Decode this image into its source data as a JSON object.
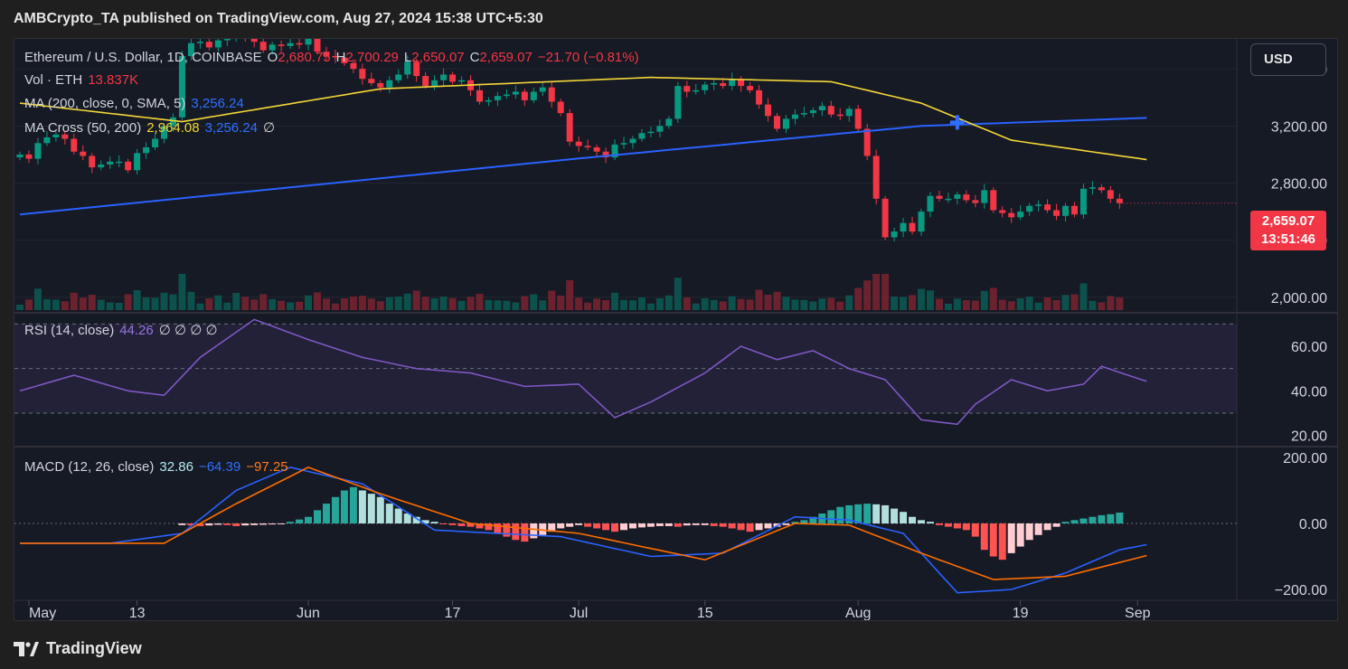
{
  "header": {
    "publisher": "AMBCrypto_TA published on TradingView.com, Aug 27, 2024 15:38 UTC+5:30"
  },
  "legend": {
    "symbol": "Ethereum / U.S. Dollar, 1D, COINBASE",
    "o_label": "O",
    "o_value": "2,680.75",
    "h_label": "H",
    "h_value": "2,700.29",
    "l_label": "L",
    "l_value": "2,650.07",
    "c_label": "C",
    "c_value": "2,659.07",
    "change": "−21.70 (−0.81%)",
    "vol_label": "Vol · ETH",
    "vol_value": "13.837K",
    "ma_label": "MA (200, close, 0, SMA, 5)",
    "ma_value": "3,256.24",
    "macross_label": "MA Cross (50, 200)",
    "macross_v1": "2,964.08",
    "macross_v2": "3,256.24",
    "macross_v3": "∅",
    "rsi_label": "RSI (14, close)",
    "rsi_value": "44.26",
    "rsi_extra": "∅ ∅ ∅ ∅",
    "macd_label": "MACD (12, 26, close)",
    "macd_hist": "32.86",
    "macd_line": "−64.39",
    "macd_signal": "−97.25"
  },
  "toolbar": {
    "currency_button": "USD"
  },
  "price_badge": {
    "price": "2,659.07",
    "countdown": "13:51:46"
  },
  "footer": {
    "brand": "TradingView"
  },
  "colors": {
    "background": "#161a25",
    "up": "#089981",
    "down": "#f23645",
    "ma200": "#2962ff",
    "ma50": "#f5d637",
    "rsi": "#7e57c2",
    "macd_line": "#2962ff",
    "macd_signal": "#ff6d00"
  },
  "chart_data": [
    {
      "type": "candlestick",
      "title": "Ethereum / U.S. Dollar, 1D, COINBASE",
      "y_ticks": [
        "3,600.00",
        "3,200.00",
        "2,800.00",
        "2,400.00",
        "2,000.00"
      ],
      "y_tick_values": [
        3600,
        3200,
        2800,
        2400,
        2000
      ],
      "ylim": [
        1910,
        3810
      ],
      "x_ticks": [
        "May",
        "13",
        "Jun",
        "17",
        "Jul",
        "15",
        "Aug",
        "19",
        "Sep"
      ],
      "x_tick_dates": [
        "2024-05-01",
        "2024-05-13",
        "2024-06-01",
        "2024-06-17",
        "2024-07-01",
        "2024-07-15",
        "2024-08-01",
        "2024-08-19",
        "2024-09-01"
      ],
      "start_date": "2024-04-30",
      "closes": [
        3000,
        2970,
        3080,
        3120,
        3140,
        3110,
        3020,
        2990,
        2910,
        2930,
        2950,
        2950,
        2890,
        3010,
        3050,
        3110,
        3200,
        3260,
        3690,
        3780,
        3790,
        3750,
        3800,
        3810,
        3890,
        3820,
        3790,
        3730,
        3770,
        3760,
        3780,
        3770,
        3820,
        3720,
        3690,
        3680,
        3640,
        3600,
        3530,
        3500,
        3470,
        3520,
        3560,
        3650,
        3550,
        3480,
        3520,
        3560,
        3510,
        3520,
        3450,
        3370,
        3380,
        3410,
        3420,
        3440,
        3380,
        3440,
        3470,
        3370,
        3290,
        3090,
        3060,
        3050,
        3020,
        2980,
        3070,
        3080,
        3110,
        3150,
        3160,
        3200,
        3250,
        3480,
        3440,
        3450,
        3490,
        3500,
        3480,
        3530,
        3480,
        3450,
        3350,
        3270,
        3180,
        3250,
        3280,
        3290,
        3310,
        3340,
        3280,
        3270,
        3320,
        3180,
        2990,
        2690,
        2420,
        2460,
        2520,
        2460,
        2600,
        2710,
        2690,
        2690,
        2720,
        2680,
        2660,
        2750,
        2610,
        2590,
        2560,
        2600,
        2640,
        2650,
        2610,
        2570,
        2640,
        2580,
        2760,
        2770,
        2750,
        2690,
        2659
      ],
      "ma200": [
        {
          "day": 0,
          "value": 2580
        },
        {
          "day": 60,
          "value": 2960
        },
        {
          "day": 100,
          "value": 3200
        },
        {
          "day": 125,
          "value": 3256.24
        }
      ],
      "ma50": [
        {
          "day": 0,
          "value": 3360
        },
        {
          "day": 18,
          "value": 3230
        },
        {
          "day": 40,
          "value": 3460
        },
        {
          "day": 70,
          "value": 3540
        },
        {
          "day": 90,
          "value": 3510
        },
        {
          "day": 100,
          "value": 3360
        },
        {
          "day": 110,
          "value": 3100
        },
        {
          "day": 125,
          "value": 2964.08
        }
      ],
      "cross_marker": {
        "day": 104,
        "value": 3225
      },
      "last_price": 2659.07
    },
    {
      "type": "line",
      "title": "RSI (14, close)",
      "y_ticks": [
        "60.00",
        "40.00",
        "20.00"
      ],
      "y_tick_values": [
        60,
        40,
        20
      ],
      "ylim": [
        15,
        75
      ],
      "bands": [
        70,
        50,
        30
      ],
      "values": [
        {
          "day": 0,
          "value": 40
        },
        {
          "day": 6,
          "value": 47
        },
        {
          "day": 12,
          "value": 40
        },
        {
          "day": 16,
          "value": 38
        },
        {
          "day": 20,
          "value": 55
        },
        {
          "day": 26,
          "value": 72
        },
        {
          "day": 32,
          "value": 63
        },
        {
          "day": 38,
          "value": 55
        },
        {
          "day": 44,
          "value": 50
        },
        {
          "day": 50,
          "value": 48
        },
        {
          "day": 56,
          "value": 42
        },
        {
          "day": 62,
          "value": 43
        },
        {
          "day": 66,
          "value": 28
        },
        {
          "day": 70,
          "value": 35
        },
        {
          "day": 76,
          "value": 48
        },
        {
          "day": 80,
          "value": 60
        },
        {
          "day": 84,
          "value": 54
        },
        {
          "day": 88,
          "value": 58
        },
        {
          "day": 92,
          "value": 50
        },
        {
          "day": 96,
          "value": 45
        },
        {
          "day": 100,
          "value": 27
        },
        {
          "day": 104,
          "value": 25
        },
        {
          "day": 106,
          "value": 34
        },
        {
          "day": 110,
          "value": 45
        },
        {
          "day": 114,
          "value": 40
        },
        {
          "day": 118,
          "value": 43
        },
        {
          "day": 120,
          "value": 51
        },
        {
          "day": 125,
          "value": 44.26
        }
      ]
    },
    {
      "type": "line+bar",
      "title": "MACD (12, 26, close)",
      "y_ticks": [
        "200.00",
        "0.00",
        "−200.00"
      ],
      "y_tick_values": [
        200,
        0,
        -200
      ],
      "ylim": [
        -230,
        230
      ],
      "macd": [
        {
          "day": 0,
          "value": -60
        },
        {
          "day": 10,
          "value": -60
        },
        {
          "day": 18,
          "value": -30
        },
        {
          "day": 24,
          "value": 100
        },
        {
          "day": 30,
          "value": 170
        },
        {
          "day": 38,
          "value": 120
        },
        {
          "day": 46,
          "value": -20
        },
        {
          "day": 60,
          "value": -40
        },
        {
          "day": 70,
          "value": -100
        },
        {
          "day": 78,
          "value": -90
        },
        {
          "day": 86,
          "value": 20
        },
        {
          "day": 92,
          "value": 10
        },
        {
          "day": 98,
          "value": -30
        },
        {
          "day": 104,
          "value": -210
        },
        {
          "day": 110,
          "value": -200
        },
        {
          "day": 116,
          "value": -150
        },
        {
          "day": 122,
          "value": -80
        },
        {
          "day": 125,
          "value": -64.39
        }
      ],
      "signal": [
        {
          "day": 0,
          "value": -60
        },
        {
          "day": 16,
          "value": -60
        },
        {
          "day": 24,
          "value": 60
        },
        {
          "day": 32,
          "value": 170
        },
        {
          "day": 40,
          "value": 90
        },
        {
          "day": 50,
          "value": 0
        },
        {
          "day": 62,
          "value": -30
        },
        {
          "day": 76,
          "value": -110
        },
        {
          "day": 86,
          "value": 0
        },
        {
          "day": 92,
          "value": -5
        },
        {
          "day": 100,
          "value": -90
        },
        {
          "day": 108,
          "value": -170
        },
        {
          "day": 116,
          "value": -160
        },
        {
          "day": 125,
          "value": -97.25
        }
      ],
      "histogram": [
        -5,
        -6,
        -8,
        -6,
        -4,
        -5,
        -8,
        -6,
        -5,
        -4,
        -3,
        -2,
        5,
        12,
        20,
        40,
        60,
        80,
        100,
        110,
        100,
        90,
        80,
        60,
        45,
        30,
        20,
        10,
        5,
        -2,
        -5,
        -8,
        -10,
        -15,
        -20,
        -30,
        -40,
        -50,
        -55,
        -45,
        -35,
        -25,
        -15,
        -10,
        -5,
        -10,
        -15,
        -20,
        -25,
        -20,
        -15,
        -12,
        -10,
        -8,
        -8,
        -10,
        -6,
        -5,
        -5,
        -8,
        -10,
        -15,
        -20,
        -25,
        -20,
        -15,
        -10,
        -5,
        5,
        10,
        20,
        30,
        40,
        50,
        55,
        58,
        60,
        58,
        55,
        45,
        35,
        20,
        10,
        5,
        -5,
        -10,
        -15,
        -20,
        -40,
        -80,
        -100,
        -110,
        -90,
        -70,
        -50,
        -35,
        -20,
        -10,
        5,
        10,
        15,
        20,
        25,
        28,
        32.86
      ],
      "hist_start_day": 20
    }
  ]
}
